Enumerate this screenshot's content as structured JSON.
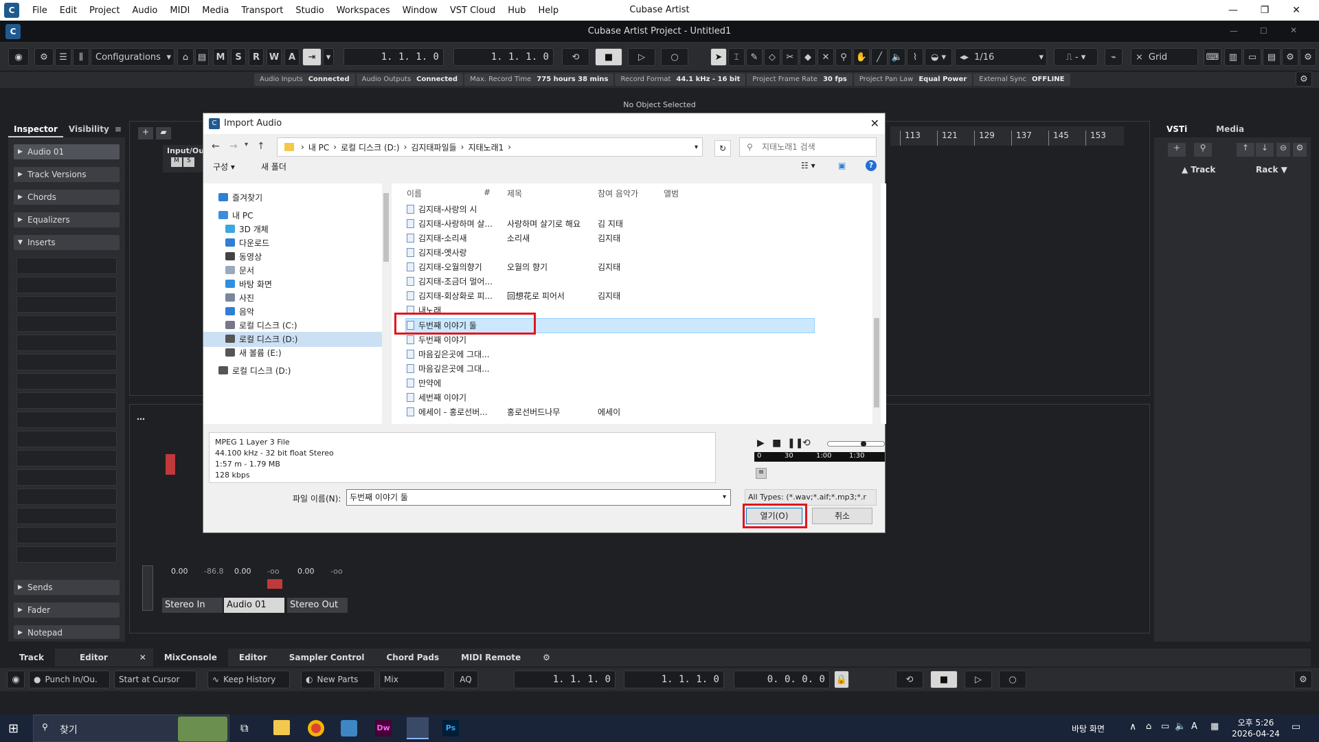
{
  "menubar": {
    "items": [
      "File",
      "Edit",
      "Project",
      "Audio",
      "MIDI",
      "Media",
      "Transport",
      "Studio",
      "Workspaces",
      "Window",
      "VST Cloud",
      "Hub",
      "Help"
    ],
    "app_title": "Cubase Artist"
  },
  "project": {
    "title": "Cubase Artist Project - Untitled1"
  },
  "toolbar": {
    "configurations": "Configurations",
    "msrwa": [
      "M",
      "S",
      "R",
      "W",
      "A"
    ],
    "left_locator": "1. 1. 1.  0",
    "right_locator": "1. 1. 1.  0",
    "quantize": "1/16",
    "snap_type": "Grid"
  },
  "status": [
    {
      "label": "Audio Inputs",
      "value": "Connected"
    },
    {
      "label": "Audio Outputs",
      "value": "Connected"
    },
    {
      "label": "Max. Record Time",
      "value": "775 hours 38 mins"
    },
    {
      "label": "Record Format",
      "value": "44.1 kHz - 16 bit"
    },
    {
      "label": "Project Frame Rate",
      "value": "30 fps"
    },
    {
      "label": "Project Pan Law",
      "value": "Equal Power"
    },
    {
      "label": "External Sync",
      "value": "OFFLINE"
    }
  ],
  "no_object": "No Object Selected",
  "inspector": {
    "tabs": [
      "Inspector",
      "Visibility"
    ],
    "track_name": "Audio 01",
    "sections": [
      "Track Versions",
      "Chords",
      "Equalizers",
      "Inserts",
      "Sends",
      "Fader",
      "Notepad"
    ]
  },
  "ruler_ticks": [
    "113",
    "121",
    "129",
    "137",
    "145",
    "153"
  ],
  "track": {
    "io_label": "Input/Out"
  },
  "mixer": {
    "strips": [
      "Stereo In",
      "Audio 01",
      "Stereo Out"
    ],
    "values": [
      "0.00",
      "-86.8",
      "0.00",
      "-oo",
      "0.00",
      "-oo"
    ]
  },
  "right_zone": {
    "tabs": [
      "VSTi",
      "Media"
    ],
    "cols": [
      "Track",
      "Rack"
    ]
  },
  "bottom_tabs": [
    "Track",
    "Editor",
    "MixConsole",
    "Editor",
    "Sampler Control",
    "Chord Pads",
    "MIDI Remote"
  ],
  "transport": {
    "punch": "Punch In/Ou.",
    "start": "Start at Cursor",
    "history": "Keep History",
    "new_parts": "New Parts",
    "mix": "Mix",
    "aq": "AQ",
    "pos1": "1.  1.  1.   0",
    "pos2": "1.  1.  1.   0",
    "pos3": "0.  0.  0.   0"
  },
  "dialog": {
    "title": "Import Audio",
    "breadcrumb": [
      "내 PC",
      "로컬 디스크 (D:)",
      "김지태파일들",
      "지태노래1"
    ],
    "search_placeholder": "지태노래1 검색",
    "organize": "구성 ▾",
    "new_folder": "새 폴더",
    "nav": [
      {
        "label": "즐겨찾기",
        "color": "#2f7fd6"
      },
      {
        "label": "내 PC",
        "color": "#3b8de0"
      },
      {
        "label": "3D 개체",
        "color": "#3aa7e0"
      },
      {
        "label": "다운로드",
        "color": "#2f7fd6"
      },
      {
        "label": "동영상",
        "color": "#444"
      },
      {
        "label": "문서",
        "color": "#9ab"
      },
      {
        "label": "바탕 화면",
        "color": "#2f8ee0"
      },
      {
        "label": "사진",
        "color": "#789"
      },
      {
        "label": "음악",
        "color": "#2f7fd6"
      },
      {
        "label": "로컬 디스크 (C:)",
        "color": "#778"
      },
      {
        "label": "로컬 디스크 (D:)",
        "color": "#555"
      },
      {
        "label": "새 볼륨 (E:)",
        "color": "#555"
      },
      {
        "label": "로컬 디스크 (D:)",
        "color": "#555"
      }
    ],
    "columns": [
      "이름",
      "#",
      "제목",
      "참여 음악가",
      "앨범"
    ],
    "files": [
      {
        "name": "김지태-사랑의 시",
        "title": "",
        "artist": ""
      },
      {
        "name": "김지태-사랑하며 살...",
        "title": "사랑하며 살기로 해요",
        "artist": "김 지태"
      },
      {
        "name": "김지태-소리새",
        "title": "소리새",
        "artist": "김지태"
      },
      {
        "name": "김지태-옛사랑",
        "title": "",
        "artist": ""
      },
      {
        "name": "김지태-오월의향기",
        "title": "오월의 향기",
        "artist": "김지태"
      },
      {
        "name": "김지태-조금더 멀어...",
        "title": "",
        "artist": ""
      },
      {
        "name": "김지태-회상화로 피...",
        "title": "回想花로 피어서",
        "artist": "김지태"
      },
      {
        "name": "내노래",
        "title": "",
        "artist": ""
      },
      {
        "name": "두번째 이야기 둘",
        "title": "",
        "artist": ""
      },
      {
        "name": "두번째 이야기",
        "title": "",
        "artist": ""
      },
      {
        "name": "마음깊은곳에 그대...",
        "title": "",
        "artist": ""
      },
      {
        "name": "마음깊은곳에 그대...",
        "title": "",
        "artist": ""
      },
      {
        "name": "만약에",
        "title": "",
        "artist": ""
      },
      {
        "name": "세번째 이야기",
        "title": "",
        "artist": ""
      },
      {
        "name": "에세이 - 홍로선버...",
        "title": "홍로선버드나무",
        "artist": "에세이"
      }
    ],
    "info": [
      "MPEG 1 Layer 3 File",
      "44.100 kHz - 32 bit float Stereo",
      "1:57 m - 1.79 MB",
      "128 kbps"
    ],
    "timeline": [
      "0",
      "30",
      "1:00",
      "1:30"
    ],
    "filename_label": "파일 이름(N):",
    "filename_value": "두번째 이야기 둘",
    "filter": "All Types: (*.wav;*.aif;*.mp3;*.r",
    "open": "열기(O)",
    "cancel": "취소"
  },
  "taskbar": {
    "search": "찾기",
    "desktop": "바탕 화면",
    "time": "오후 5:26",
    "date": "2026-04-24"
  }
}
